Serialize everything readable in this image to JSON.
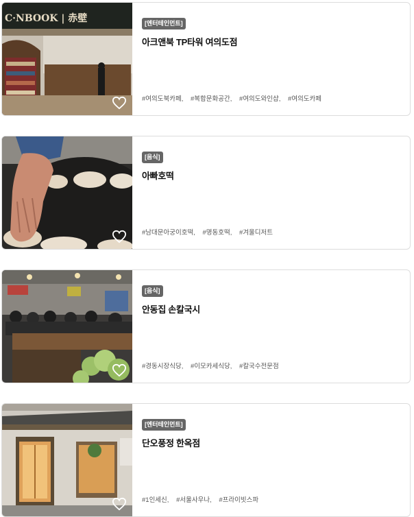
{
  "cards": [
    {
      "category": "[엔터테인먼트]",
      "title": "아크앤북 TP타워 여의도점",
      "tags": [
        "#여의도북카페,",
        "#복합문화공간,",
        "#여의도와인샵,",
        "#여의도카페"
      ],
      "image_sign_text": "C·NBOOK | 赤壁"
    },
    {
      "category": "[음식]",
      "title": "아빠호떡",
      "tags": [
        "#남대문아궁이호떡,",
        "#명동호떡,",
        "#겨울디저트"
      ]
    },
    {
      "category": "[음식]",
      "title": "안동집 손칼국시",
      "tags": [
        "#경동시장식당,",
        "#이모카세식당,",
        "#칼국수전문점"
      ]
    },
    {
      "category": "[엔터테인먼트]",
      "title": "단오풍정 한옥점",
      "tags": [
        "#1인세신,",
        "#서울사우나,",
        "#프라이빗스파"
      ]
    }
  ]
}
